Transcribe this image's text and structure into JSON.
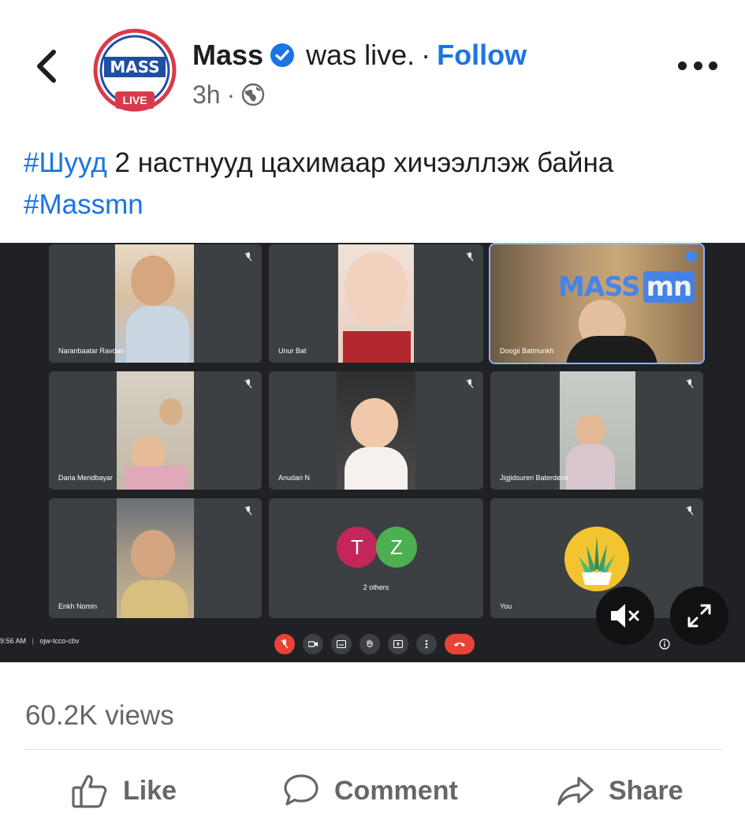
{
  "header": {
    "page_name": "Mass",
    "was_live": "was live.",
    "separator": "·",
    "follow": "Follow",
    "time": "3h",
    "meta_dot": "·",
    "avatar_logo": "MASS",
    "avatar_badge": "LIVE"
  },
  "post": {
    "hashtag1": "#Шууд",
    "text": " 2 настнууд цахимаар хичээллэж байна ",
    "hashtag2": "#Massmn"
  },
  "video": {
    "watermark": "MASS",
    "watermark_suffix": "mn",
    "participants": [
      {
        "name": "Naranbaatar Ravdan"
      },
      {
        "name": "Unur Bat"
      },
      {
        "name": "Doogii Batmunkh"
      },
      {
        "name": "Daria Mendbayar"
      },
      {
        "name": "Anudari N"
      },
      {
        "name": "Jigjidsuren Baterdene"
      },
      {
        "name": "Enkh Nomin"
      },
      {
        "name": "2 others",
        "initials": [
          "T",
          "Z"
        ]
      },
      {
        "name": "You"
      }
    ],
    "time": "9:56 AM",
    "divider": "|",
    "meeting_code": "ojw-tcco-cbv"
  },
  "footer": {
    "views": "60.2K views",
    "like": "Like",
    "comment": "Comment",
    "share": "Share"
  },
  "colors": {
    "accent": "#1b74e4",
    "meet_bg": "#202124",
    "tile_bg": "#3c4043",
    "end_call": "#ea4335",
    "avatar_t": "#c5265a",
    "avatar_z": "#4caf50"
  }
}
